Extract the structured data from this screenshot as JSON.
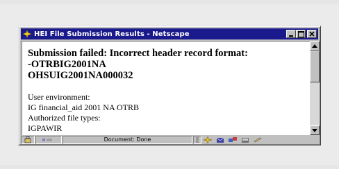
{
  "window": {
    "title": "HEI File Submission Results - Netscape",
    "icons": [
      "netscape-app-icon",
      "minimize-icon",
      "maximize-icon",
      "close-icon"
    ]
  },
  "document": {
    "heading_lines": [
      "Submission failed: Incorrect header record format:",
      "-OTRBIG2001NA",
      "OHSUIG2001NA000032"
    ],
    "body_lines": [
      "User environment:",
      "IG financial_aid 2001 NA OTRB",
      "Authorized file types:",
      "IGPAWIR"
    ]
  },
  "statusbar": {
    "status_text": "Document: Done",
    "icons": [
      "security-lock-icon",
      "progress-icon",
      "dashboard-icon",
      "navigator-icon",
      "mail-icon",
      "discussion-icon",
      "composer-icon",
      "edit-icon"
    ]
  },
  "colors": {
    "titlebar": "#1a1a8c",
    "chrome": "#c0c0c0",
    "backdrop": "#ebebeb"
  }
}
